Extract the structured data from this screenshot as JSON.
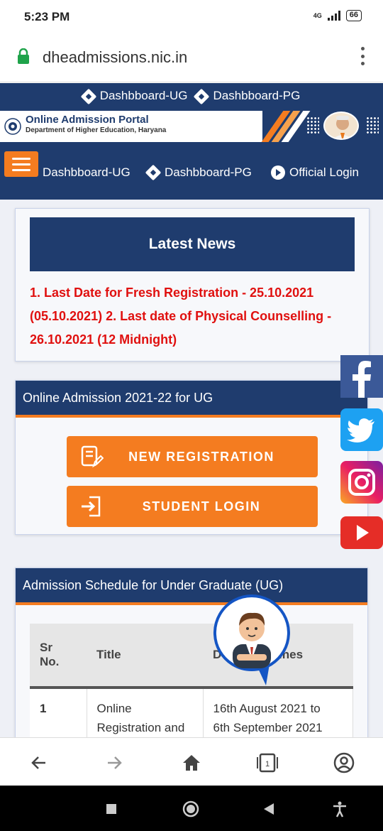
{
  "status_bar": {
    "time": "5:23 PM",
    "network": "4G",
    "battery": "66"
  },
  "browser": {
    "url": "dheadmissions.nic.in"
  },
  "top_nav": {
    "items": [
      "Dashbboard-UG",
      "Dashbboard-PG"
    ]
  },
  "header": {
    "title": "Online Admission Portal",
    "subtitle": "Department of Higher Education, Haryana"
  },
  "main_nav": {
    "items": [
      "Dashbboard-UG",
      "Dashbboard-PG",
      "Official Login"
    ]
  },
  "news": {
    "heading": "Latest News",
    "line1": "1. Last Date for Fresh Registration - 25.10.2021",
    "line2": "(05.10.2021) 2. Last date of Physical Counselling -",
    "line3": "26.10.2021 (12 Midnight)"
  },
  "ug_admission": {
    "heading": "Online Admission 2021-22 for UG",
    "new_registration": "NEW REGISTRATION",
    "student_login": "STUDENT LOGIN"
  },
  "schedule": {
    "heading": "Admission Schedule for Under Graduate (UG)",
    "columns": {
      "sr": "Sr",
      "sr2": "No.",
      "title": "Title",
      "deadline_start": "D",
      "deadline_end": "lines"
    },
    "rows": [
      {
        "sr": "1",
        "title_line1": "Online",
        "title_line2": "Registration and",
        "date_line1": "16th August 2021 to",
        "date_line2": "6th September 2021"
      }
    ]
  },
  "social": [
    "facebook-icon",
    "twitter-icon",
    "instagram-icon",
    "youtube-icon"
  ],
  "colors": {
    "navy": "#1f3c6e",
    "orange": "#f47c20",
    "news_red": "#e0100f"
  }
}
